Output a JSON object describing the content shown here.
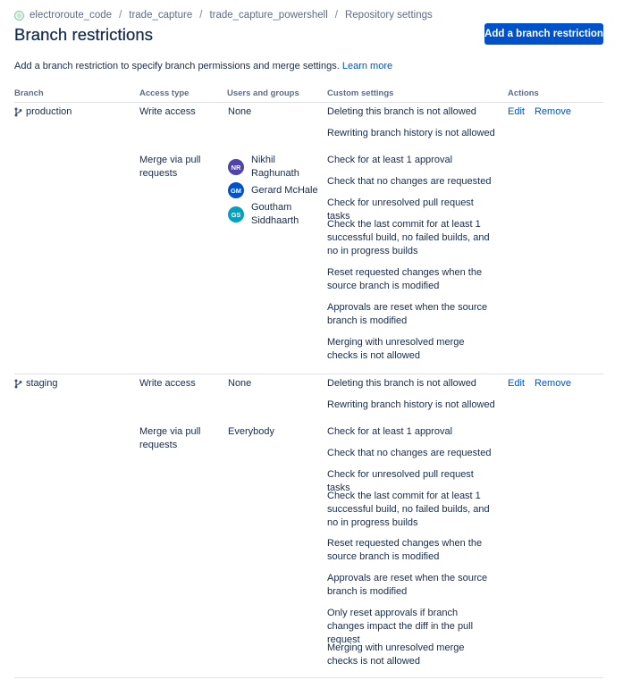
{
  "breadcrumb": [
    "electroroute_code",
    "trade_capture",
    "trade_capture_powershell",
    "Repository settings"
  ],
  "title": "Branch restrictions",
  "add_button": "Add a branch restriction",
  "intro": "Add a branch restriction to specify branch permissions and merge settings.",
  "learn_more": "Learn more",
  "headers": {
    "branch": "Branch",
    "access_type": "Access type",
    "users": "Users and groups",
    "custom": "Custom settings",
    "actions": "Actions"
  },
  "actions": {
    "edit": "Edit",
    "remove": "Remove"
  },
  "rows": [
    {
      "branch": "production",
      "write": {
        "access": "Write access",
        "users": "None",
        "settings": [
          "Deleting this branch is not allowed",
          "Rewriting branch history is not allowed"
        ]
      },
      "merge": {
        "access": "Merge via pull requests",
        "users": [
          {
            "initials": "NR",
            "name": "Nikhil Raghunath",
            "color": "#5243aa"
          },
          {
            "initials": "GM",
            "name": "Gerard McHale",
            "color": "#0052cc"
          },
          {
            "initials": "GS",
            "name": "Goutham Siddhaarth",
            "color": "#00a3bf"
          }
        ],
        "settings": [
          "Check for at least 1 approval",
          "Check that no changes are requested",
          "Check for unresolved pull request tasks",
          "Check the last commit for at least 1 successful build, no failed builds, and no in progress builds",
          "Reset requested changes when the source branch is modified",
          "Approvals are reset when the source branch is modified",
          "Merging with unresolved merge checks is not allowed"
        ]
      }
    },
    {
      "branch": "staging",
      "write": {
        "access": "Write access",
        "users": "None",
        "settings": [
          "Deleting this branch is not allowed",
          "Rewriting branch history is not allowed"
        ]
      },
      "merge": {
        "access": "Merge via pull requests",
        "users_text": "Everybody",
        "settings": [
          "Check for at least 1 approval",
          "Check that no changes are requested",
          "Check for unresolved pull request tasks",
          "Check the last commit for at least 1 successful build, no failed builds, and no in progress builds",
          "Reset requested changes when the source branch is modified",
          "Approvals are reset when the source branch is modified",
          "Only reset approvals if branch changes impact the diff in the pull request",
          "Merging with unresolved merge checks is not allowed"
        ]
      }
    }
  ],
  "colors": {
    "primary": "#0052cc",
    "text": "#172b4d",
    "muted": "#5e6c84",
    "border": "#dfe1e6"
  }
}
